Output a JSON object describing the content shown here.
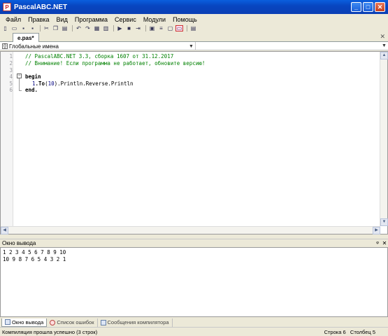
{
  "window": {
    "title": "PascalABC.NET"
  },
  "menu": [
    "Файл",
    "Правка",
    "Вид",
    "Программа",
    "Сервис",
    "Модули",
    "Помощь"
  ],
  "tab": {
    "label": "e.pas*"
  },
  "nav": {
    "combo_label": "Глобальные имена"
  },
  "editor": {
    "line_numbers": [
      "1",
      "2",
      "3",
      "4",
      "5",
      "6"
    ],
    "comment1": "// PascalABC.NET 3.3, сборка 1607 от 31.12.2017",
    "comment2": "// Внимание! Если программа не работает, обновите версию!",
    "kw_begin": "begin",
    "code_num": "1",
    "code_to": ".To",
    "code_paren_open": "(",
    "code_arg": "10",
    "code_rest": ").Println.Reverse.Println",
    "kw_end": "end."
  },
  "output": {
    "title": "Окно вывода",
    "lines": [
      "1 2 3 4 5 6 7 8 9 10",
      "10 9 8 7 6 5 4 3 2 1"
    ]
  },
  "bottom_tabs": [
    "Окно вывода",
    "Список ошибок",
    "Сообщения компилятора"
  ],
  "status": {
    "message": "Компиляция прошла успешно (3 строк)",
    "line_label": "Строка",
    "line_value": "6",
    "col_label": "Столбец",
    "col_value": "5"
  }
}
